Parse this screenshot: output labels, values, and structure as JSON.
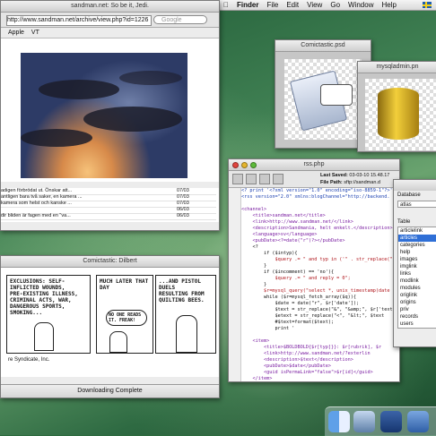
{
  "menubar": {
    "apple": "",
    "items": [
      "Finder",
      "File",
      "Edit",
      "View",
      "Go",
      "Window",
      "Help"
    ]
  },
  "browser": {
    "title": "sandman.net: So be it, Jedi.",
    "url": "http://www.sandman.net/archive/view.php?id=1226",
    "search_placeholder": "Google",
    "bookmarks": [
      "Apple",
      "VT"
    ],
    "list": [
      {
        "title": "adigen förbrödat ut. Önskar att...",
        "date": "07/03"
      },
      {
        "title": "antligen bara två saker, en kamera ...",
        "date": "07/03"
      },
      {
        "title": "kamera som helst och kanske ...",
        "date": "07/03"
      },
      {
        "title": "",
        "date": "06/03"
      },
      {
        "title": "dir bliden är fagen med en \"va...",
        "date": "06/03"
      }
    ]
  },
  "comic": {
    "title": "Comictastic: Dilbert",
    "panel1": [
      "EXCLUSIONS: SELF-",
      "INFLICTED WOUNDS,",
      "PRE-EXISTING ILLNESS,",
      "CRIMINAL ACTS, WAR,",
      "DANGEROUS SPORTS,",
      "SMOKING..."
    ],
    "panel2_top": "MUCH LATER THAT DAY",
    "panel2_mid": "NO ONE READS IT. FREAK!",
    "panel3": [
      "...AND PISTOL DUELS",
      "RESULTING FROM",
      "QUILTING BEES."
    ],
    "footer": "re Syndicate, Inc.",
    "status": "Downloading Complete"
  },
  "psd_window": {
    "title": "Comictastic.psd"
  },
  "sql_window": {
    "title": "mysqladmin.pn"
  },
  "editor": {
    "title": "rss.php",
    "last_saved_label": "Last Saved:",
    "last_saved": "03-03-10 15.48.17",
    "file_path_label": "File Path:",
    "file_path": "sftp://sandman.d",
    "code": [
      {
        "t": "<? print '<?xml version=\"1.0\" encoding=\"iso-8859-1\"?>'; ?>",
        "c": "c-blue"
      },
      {
        "t": "<rss version=\"2.0\" xmlns:blogChannel=\"http://backend.",
        "c": "c-blue"
      },
      {
        "t": "",
        "c": ""
      },
      {
        "t": "<channel>",
        "c": "c-purple"
      },
      {
        "t": "    <title>sandman.net</title>",
        "c": "c-purple"
      },
      {
        "t": "    <link>http://www.sandman.net/</link>",
        "c": "c-purple"
      },
      {
        "t": "    <description>Sandmania, helt enkelt.</description>",
        "c": "c-purple"
      },
      {
        "t": "    <language>sv</language>",
        "c": "c-purple"
      },
      {
        "t": "    <pubDate><?=date(\"r\")?></pubDate>",
        "c": "c-purple"
      },
      {
        "t": "    <?",
        "c": ""
      },
      {
        "t": "        if ($intyp){",
        "c": ""
      },
      {
        "t": "            $query .= \" and typ in ('\" . str_replace(\",",
        "c": "c-red"
      },
      {
        "t": "        }",
        "c": ""
      },
      {
        "t": "        if ($incomment) == 'no'){",
        "c": ""
      },
      {
        "t": "            $query .= \" and reply = 0\";",
        "c": "c-red"
      },
      {
        "t": "        }",
        "c": ""
      },
      {
        "t": "        $r=mysql_query(\"select *, unix_timestamp(date",
        "c": "c-red"
      },
      {
        "t": "        while ($r=mysql_fetch_array($q)){",
        "c": ""
      },
      {
        "t": "            $date = date(\"r\", $r['date']);",
        "c": ""
      },
      {
        "t": "            $text = str_replace(\"&\", \"&amp;\", $r['text'",
        "c": ""
      },
      {
        "t": "            $etext = str_replace(\"<\", \"&lt;\", $text",
        "c": ""
      },
      {
        "t": "            #$text=format($text);",
        "c": ""
      },
      {
        "t": "            print '",
        "c": ""
      },
      {
        "t": "",
        "c": ""
      },
      {
        "t": "    <item>",
        "c": "c-purple"
      },
      {
        "t": "        <title>$BOLDBOLD{$r[typ]}}: $r[rubrik], $r",
        "c": "c-purple"
      },
      {
        "t": "        <link>http://www.sandman.net/?exterlin",
        "c": "c-purple"
      },
      {
        "t": "        <description>$text</description>",
        "c": "c-purple"
      },
      {
        "t": "        <pubDate>$date</pubDate>",
        "c": "c-purple"
      },
      {
        "t": "        <guid isPermaLink=\"false\">$r[id]</guid>",
        "c": "c-purple"
      },
      {
        "t": "    </item>",
        "c": "c-purple"
      },
      {
        "t": "        ';",
        "c": ""
      },
      {
        "t": "    }",
        "c": ""
      },
      {
        "t": "    ?>",
        "c": ""
      },
      {
        "t": "",
        "c": ""
      },
      {
        "t": "</channel>",
        "c": "c-purple"
      },
      {
        "t": "</rss>",
        "c": "c-purple"
      }
    ]
  },
  "dbpanel": {
    "database_label": "Database",
    "database": "atlas",
    "table_label": "Table",
    "tables": [
      "articlelink",
      "articles",
      "categories",
      "help",
      "images",
      "imglink",
      "links",
      "modlink",
      "modules",
      "origlink",
      "origins",
      "priv",
      "records",
      "users"
    ],
    "selected": "articles"
  },
  "colors": {
    "accent": "#2f6fd6",
    "desktop": "#2d6a3e"
  }
}
